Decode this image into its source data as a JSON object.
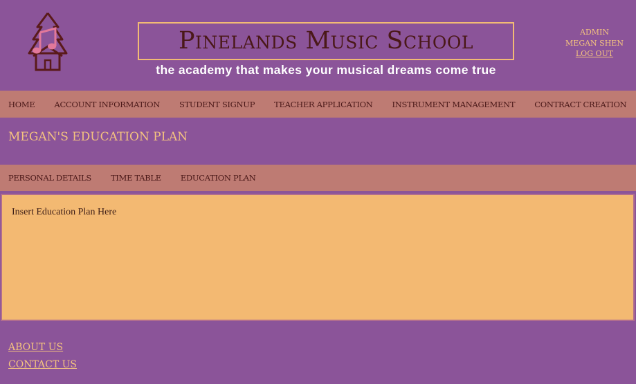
{
  "header": {
    "school_name": "Pinelands Music School",
    "tagline": "the academy that makes your musical dreams come true",
    "logo_icon": "tree-music-note-house-icon"
  },
  "user_menu": {
    "role": "Admin",
    "user_name": "Megan Shen",
    "logout_label": "Log Out"
  },
  "nav": {
    "items": [
      {
        "label": "Home"
      },
      {
        "label": "Account Information"
      },
      {
        "label": "Student Signup"
      },
      {
        "label": "Teacher Application"
      },
      {
        "label": "Instrument Management"
      },
      {
        "label": "Contract Creation"
      }
    ]
  },
  "page": {
    "title": "Megan's Education Plan"
  },
  "subnav": {
    "items": [
      {
        "label": "Personal Details"
      },
      {
        "label": "Time Table"
      },
      {
        "label": "Education Plan"
      }
    ]
  },
  "content": {
    "text": "Insert Education Plan Here"
  },
  "footer": {
    "about_label": "About Us",
    "contact_label": "Contact Us"
  },
  "colors": {
    "background": "#8b5499",
    "nav_bar": "#be7b73",
    "content_panel": "#f3b972",
    "accent_text": "#f4c37f",
    "dark_text": "#4a1818"
  }
}
